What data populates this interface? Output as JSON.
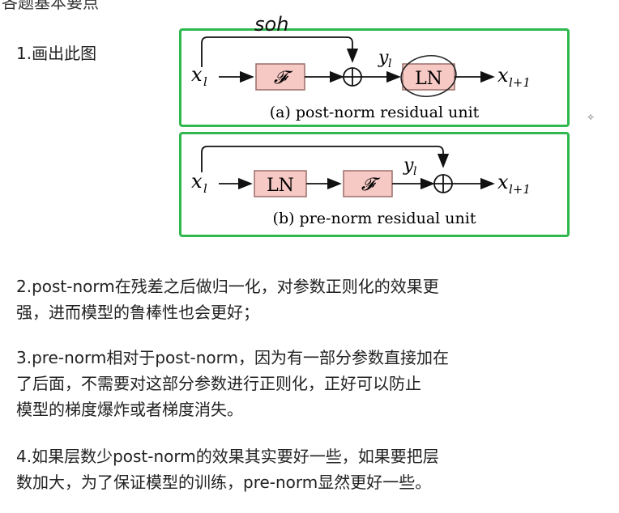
{
  "heading_fragment": "各题基本要点",
  "item1": "1.画出此图",
  "diagram_a": {
    "input": "x",
    "input_sub": "l",
    "block_f": "𝓕",
    "mid": "y",
    "mid_sub": "l",
    "ln": "LN",
    "output": "x",
    "output_sub": "l+1",
    "caption": "(a) post-norm residual unit",
    "annotation": "soh"
  },
  "diagram_b": {
    "input": "x",
    "input_sub": "l",
    "ln": "LN",
    "block_f": "𝓕",
    "mid": "y",
    "mid_sub": "l",
    "output": "x",
    "output_sub": "l+1",
    "caption": "(b) pre-norm residual unit"
  },
  "points": [
    {
      "lines": [
        "2.post-norm在残差之后做归一化，对参数正则化的效果更",
        "强，进而模型的鲁棒性也会更好；"
      ]
    },
    {
      "lines": [
        "3.pre-norm相对于post-norm，因为有一部分参数直接加在",
        "了后面，不需要对这部分参数进行正则化，正好可以防止",
        "模型的梯度爆炸或者梯度消失。"
      ]
    },
    {
      "lines": [
        "4.如果层数少post-norm的效果其实要好一些，如果要把层",
        "数加大，为了保证模型的训练，pre-norm显然更好一些。"
      ]
    }
  ],
  "colors": {
    "frame": "#2fb84d",
    "block_fill": "#f6c9c4",
    "block_stroke": "#9a6e6a"
  }
}
